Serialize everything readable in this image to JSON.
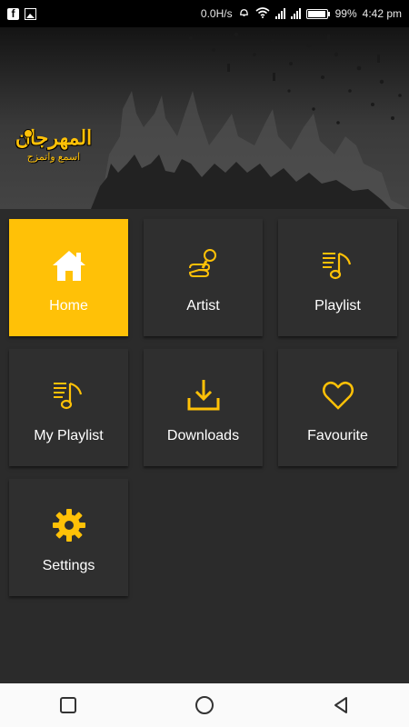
{
  "status_bar": {
    "network_speed": "0.0H/s",
    "battery": "99%",
    "time": "4:42 pm",
    "left_icons": [
      "facebook-icon",
      "image-icon"
    ],
    "right_icons": [
      "alarm-icon",
      "wifi-icon",
      "signal-icon",
      "signal-icon",
      "battery-icon"
    ]
  },
  "header": {
    "logo_title": "المهرجان",
    "logo_subtitle": "اسمع واتمزج"
  },
  "menu": {
    "items": [
      {
        "label": "Home",
        "icon": "home-icon",
        "active": true
      },
      {
        "label": "Artist",
        "icon": "microphone-hand-icon",
        "active": false
      },
      {
        "label": "Playlist",
        "icon": "playlist-icon",
        "active": false
      },
      {
        "label": "My Playlist",
        "icon": "playlist-icon",
        "active": false
      },
      {
        "label": "Downloads",
        "icon": "download-icon",
        "active": false
      },
      {
        "label": "Favourite",
        "icon": "heart-icon",
        "active": false
      },
      {
        "label": "Settings",
        "icon": "gear-icon",
        "active": false
      }
    ]
  },
  "nav_bar": {
    "buttons": [
      "recents-square-icon",
      "home-circle-icon",
      "back-triangle-icon"
    ]
  },
  "colors": {
    "accent": "#ffc107",
    "background": "#2b2b2b",
    "tile": "#2f2f2f"
  }
}
